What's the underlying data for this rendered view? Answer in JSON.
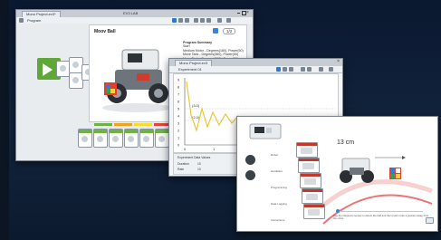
{
  "window1": {
    "tab_label": "Mono Project.ev3*",
    "program_tab": "Program",
    "toolbar_center": "EV3 LAB",
    "panel_title": "Moov Ball",
    "page_indicator": "1/2",
    "summary_lines": [
      "Program Summary",
      "Start",
      "Medium Motor - Degrees(180), Power(50)",
      "Move Tank - Degrees(360), Power(50)",
      "Move Tank - Degrees(360), Power(50)",
      "Medium Motor - Degrees(180), Power(50)"
    ]
  },
  "window2": {
    "tab_label": "Mono Project.ev3",
    "experiment_label": "Experiment 01",
    "y_ticks": [
      "9",
      "8",
      "7",
      "6",
      "5",
      "4",
      "3",
      "2",
      "1",
      "0"
    ],
    "x_ticks": [
      "0",
      "1",
      "2",
      "3",
      "4",
      "5"
    ],
    "markers": [
      "(3.0)",
      "(2.0)"
    ],
    "bottom_labels": [
      "Experiment Data Values",
      "Sensor Value",
      "Duration",
      "10",
      "Rate",
      "10"
    ]
  },
  "window3": {
    "distance_label": "13 cm",
    "menu_items": [
      "Robot",
      "Hardware",
      "Programming",
      "Data Logging",
      "Instructions"
    ],
    "caption": "Use the ultrasonic sensor to detect the ball and then push it into a position away from the robot."
  },
  "colors": {
    "accent": "#2f77c8",
    "graph_line": "#e8c22c",
    "start_block": "#5fa736",
    "swoosh": "#e23b3b"
  }
}
